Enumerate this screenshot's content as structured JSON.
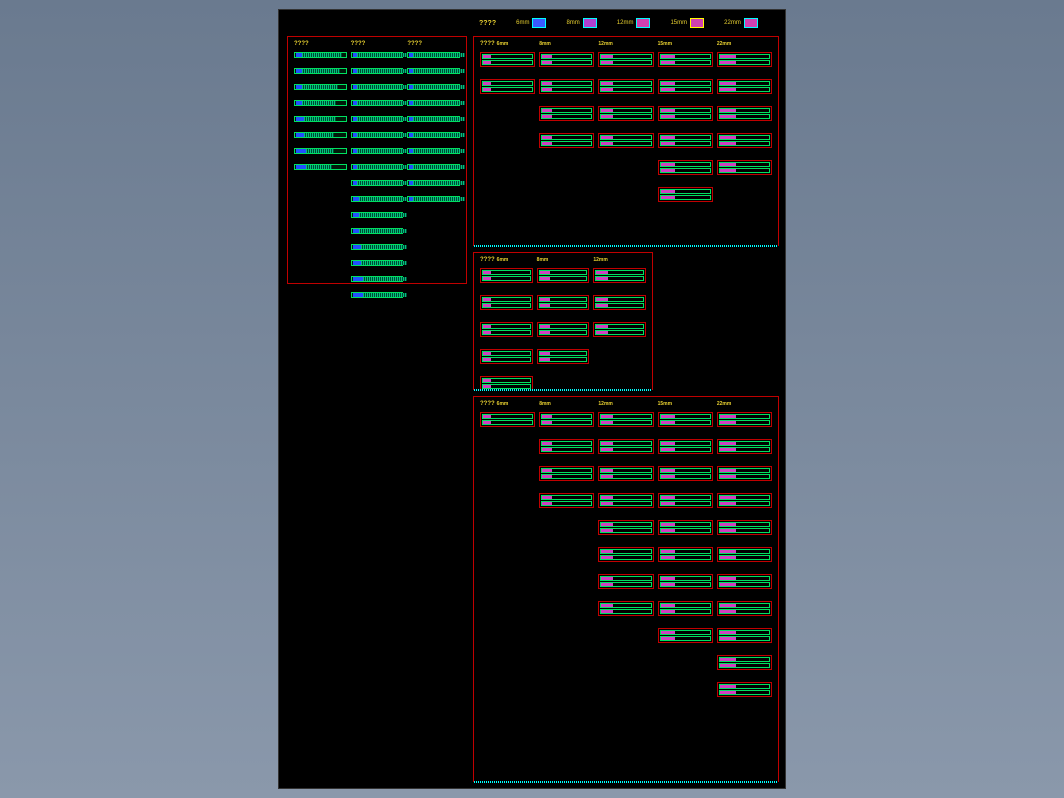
{
  "legend": {
    "title": "????",
    "items": [
      {
        "label": "6mm",
        "class": "sw-6"
      },
      {
        "label": "8mm",
        "class": "sw-8"
      },
      {
        "label": "12mm",
        "class": "sw-12"
      },
      {
        "label": "15mm",
        "class": "sw-15"
      },
      {
        "label": "22mm",
        "class": "sw-22"
      }
    ]
  },
  "panelA": {
    "cols": [
      {
        "hdr": "????",
        "bars": [
          {
            "plug": 6,
            "fill": 40
          },
          {
            "plug": 6,
            "fill": 38
          },
          {
            "plug": 6,
            "fill": 36
          },
          {
            "plug": 6,
            "fill": 34
          },
          {
            "plug": 8,
            "fill": 32
          },
          {
            "plug": 8,
            "fill": 30
          },
          {
            "plug": 10,
            "fill": 28
          },
          {
            "plug": 10,
            "fill": 26
          }
        ]
      },
      {
        "hdr": "????",
        "bars": [
          {
            "plug": 4,
            "fill": 50
          },
          {
            "plug": 4,
            "fill": 50
          },
          {
            "plug": 4,
            "fill": 50
          },
          {
            "plug": 4,
            "fill": 50
          },
          {
            "plug": 4,
            "fill": 50
          },
          {
            "plug": 4,
            "fill": 50
          },
          {
            "plug": 4,
            "fill": 50
          },
          {
            "plug": 4,
            "fill": 50
          },
          {
            "plug": 4,
            "fill": 50
          },
          {
            "plug": 6,
            "fill": 48
          },
          {
            "plug": 6,
            "fill": 48
          },
          {
            "plug": 6,
            "fill": 48
          },
          {
            "plug": 8,
            "fill": 46
          },
          {
            "plug": 8,
            "fill": 46
          },
          {
            "plug": 10,
            "fill": 44
          },
          {
            "plug": 10,
            "fill": 44
          }
        ]
      },
      {
        "hdr": "????",
        "bars": [
          {
            "plug": 4,
            "fill": 52
          },
          {
            "plug": 4,
            "fill": 52
          },
          {
            "plug": 4,
            "fill": 52
          },
          {
            "plug": 4,
            "fill": 52
          },
          {
            "plug": 4,
            "fill": 52
          },
          {
            "plug": 4,
            "fill": 52
          },
          {
            "plug": 4,
            "fill": 52
          },
          {
            "plug": 4,
            "fill": 52
          },
          {
            "plug": 4,
            "fill": 52
          },
          {
            "plug": 4,
            "fill": 52
          }
        ]
      }
    ]
  },
  "panelB": {
    "title": "????",
    "cols": [
      {
        "hdr": "6mm",
        "count": 2,
        "pink": 8
      },
      {
        "hdr": "8mm",
        "count": 4,
        "pink": 10
      },
      {
        "hdr": "12mm",
        "count": 4,
        "pink": 12
      },
      {
        "hdr": "15mm",
        "count": 6,
        "pink": 14
      },
      {
        "hdr": "22mm",
        "count": 5,
        "pink": 16
      }
    ]
  },
  "panelC": {
    "title": "????",
    "cols": [
      {
        "hdr": "6mm",
        "count": 5,
        "pink": 8
      },
      {
        "hdr": "8mm",
        "count": 4,
        "pink": 10
      },
      {
        "hdr": "12mm",
        "count": 3,
        "pink": 12
      }
    ]
  },
  "panelD": {
    "title": "????",
    "cols": [
      {
        "hdr": "6mm",
        "count": 1,
        "pink": 8
      },
      {
        "hdr": "8mm",
        "count": 4,
        "pink": 10
      },
      {
        "hdr": "12mm",
        "count": 8,
        "pink": 12
      },
      {
        "hdr": "15mm",
        "count": 9,
        "pink": 14
      },
      {
        "hdr": "22mm",
        "count": 11,
        "pink": 16
      }
    ]
  }
}
